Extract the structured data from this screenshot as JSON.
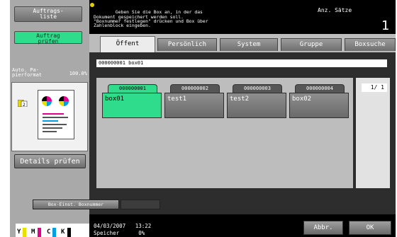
{
  "left": {
    "list_button": "Auftrags-\nliste",
    "check_button": "Auftrag\nprüfen",
    "paper_label": "Auto. Pa-\npierformat",
    "paper_pct": "100.0%",
    "details_button": "Details prüfen",
    "toner": [
      "Y",
      "M",
      "C",
      "K"
    ]
  },
  "header": {
    "message": "Geben Sie die Box an, in der das\nDokument gespeichert werden soll.\n\"Boxnummer festlegen\" drücken und Box über\nZahlenblock eingeben.",
    "count_label": "Anz. Sätze",
    "count_value": "1"
  },
  "tabs": [
    "Öffent",
    "Persönlich",
    "System",
    "Gruppe",
    "Boxsuche"
  ],
  "active_tab": "Öffent",
  "breadcrumb": "000000001  box01",
  "boxes": [
    {
      "number": "000000001",
      "name": "box01",
      "selected": true
    },
    {
      "number": "000000002",
      "name": "test1",
      "selected": false
    },
    {
      "number": "000000003",
      "name": "test2",
      "selected": false
    },
    {
      "number": "000000004",
      "name": "box02",
      "selected": false
    }
  ],
  "page_indicator": "1/  1",
  "box_settings_button": "Box-Einst. Boxnummer",
  "footer": {
    "datetime": "04/03/2007   13:22",
    "memory": "Speicher      0%",
    "cancel_button": "Abbr.",
    "ok_button": "OK"
  },
  "colors": {
    "selected": "#2fdc8b",
    "yellow": "#e8e000",
    "magenta": "#e0008c",
    "cyan": "#00a0e0",
    "black": "#000000"
  }
}
